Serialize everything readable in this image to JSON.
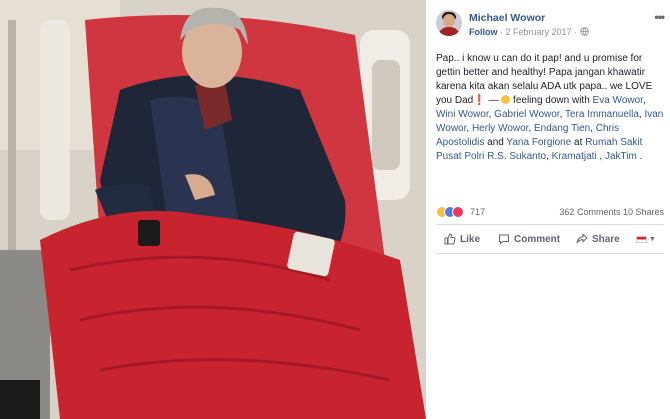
{
  "post": {
    "author": "Michael Wowor",
    "follow_label": "Follow",
    "separator": " · ",
    "date": "2 February 2017",
    "separator2": " · ",
    "privacy_icon": "globe-icon",
    "more_label": "•••",
    "text": {
      "body": "Pap.. i know u can do it pap! and u promise for gettin better and healthy! Papa jangan khawatir karena kita akan selalu ADA utk papa.. we LOVE you Dad",
      "exclaim": "❗",
      "dash": " — ",
      "feeling": " feeling down with ",
      "tags": [
        "Eva Wowor",
        "Wini Wowor",
        "Gabriel Wowor",
        "Tera Immanuella",
        "Ivan Wowor",
        "Herly Wowor",
        "Endang Tien",
        "Chris Apostolidis"
      ],
      "and": " and ",
      "last_tag": "Yana Forgione",
      "at": " at ",
      "place": "Rumah Sakit Pusat Polri R.S. Sukanto",
      "comma": ", ",
      "place2": "Kramatjati",
      "comma2": " , ",
      "place3": "JakTim",
      "end": " ."
    }
  },
  "stats": {
    "reactions_count": "717",
    "comments": "362 Comments",
    "shares": "10 Shares"
  },
  "actions": {
    "like": "Like",
    "comment": "Comment",
    "share": "Share",
    "caret": "▼"
  },
  "colors": {
    "link": "#365899",
    "like": "#4c7cf3",
    "love": "#f0385e",
    "sad": "#f5c33b",
    "blanket": "#c8242f"
  }
}
